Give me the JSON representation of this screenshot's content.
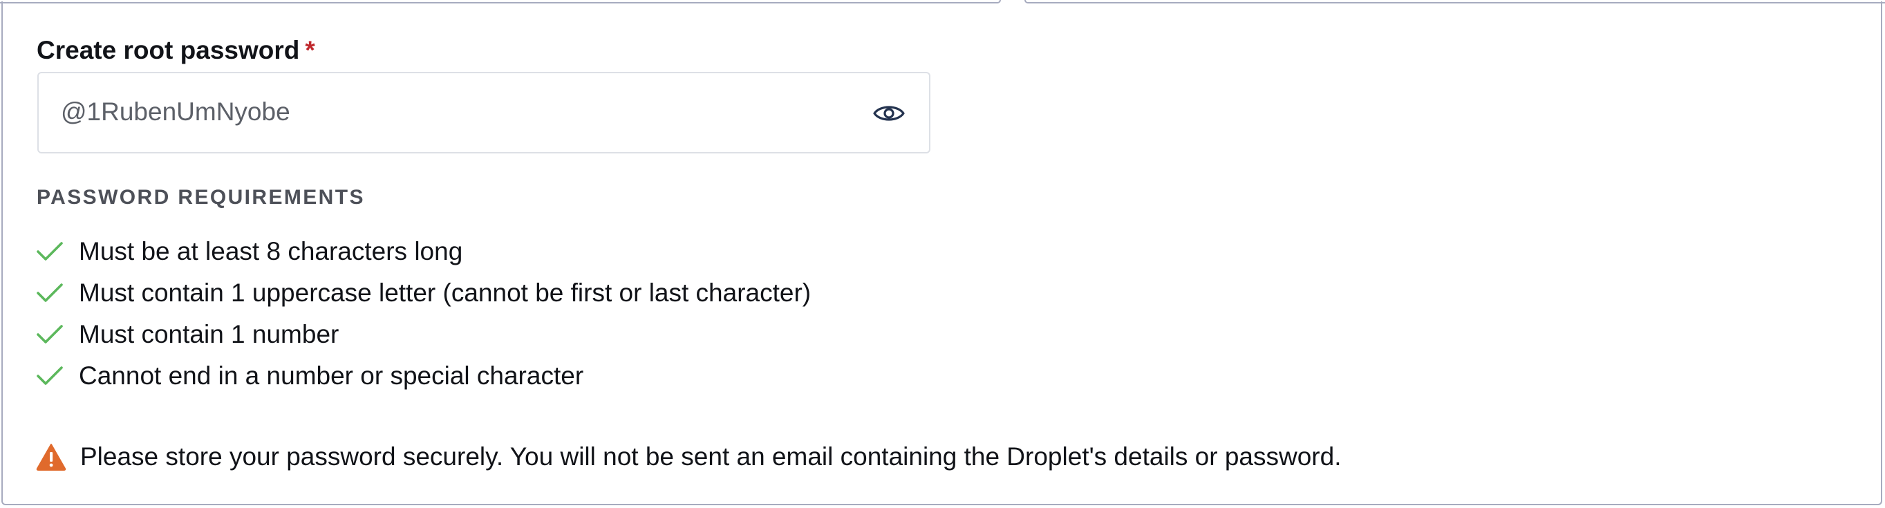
{
  "form": {
    "label": "Create root password",
    "required_mark": "*",
    "password_value": "@1RubenUmNyobe",
    "reveal_icon": "eye-icon"
  },
  "requirements": {
    "heading": "PASSWORD REQUIREMENTS",
    "check_color": "#5cb85c",
    "items": [
      {
        "text": "Must be at least 8 characters long",
        "met": true
      },
      {
        "text": "Must contain 1 uppercase letter (cannot be first or last character)",
        "met": true
      },
      {
        "text": "Must contain 1 number",
        "met": true
      },
      {
        "text": "Cannot end in a number or special character",
        "met": true
      }
    ]
  },
  "notice": {
    "icon": "warning-icon",
    "icon_color": "#e06a2c",
    "text": "Please store your password securely. You will not be sent an email containing the Droplet's details or password."
  }
}
